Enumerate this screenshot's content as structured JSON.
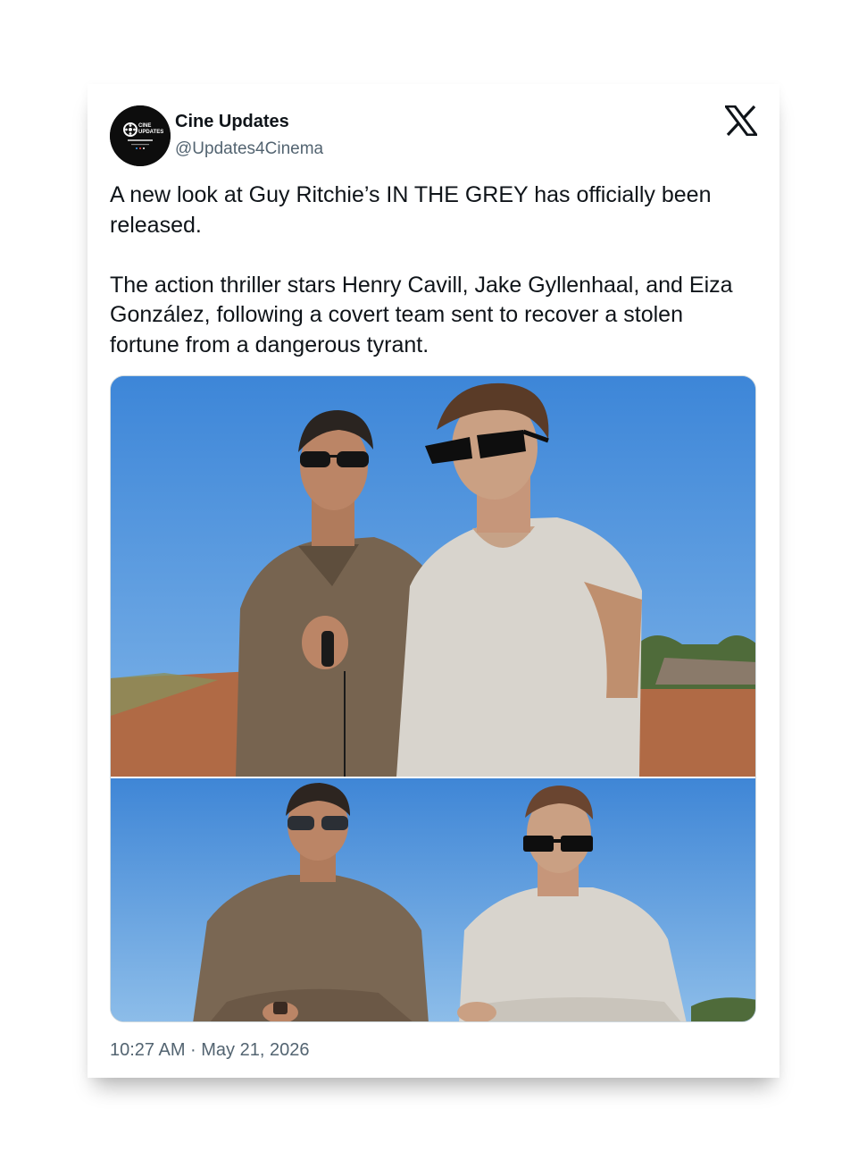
{
  "author": {
    "display_name": "Cine Updates",
    "handle": "@Updates4Cinema",
    "avatar_text": [
      "CINE",
      "UPDATES"
    ]
  },
  "platform": {
    "logo_icon": "x-logo-icon"
  },
  "tweet": {
    "paragraph_1": "A new look at Guy Ritchie’s IN THE GREY has officially been released.",
    "paragraph_2": "The action thriller stars Henry Cavill, Jake Gyllenhaal, and Eiza González, following a covert team sent to recover a stolen fortune from a dangerous tyrant."
  },
  "timestamp": "10:27 AM · May 21, 2026",
  "colors": {
    "text_primary": "#0f1419",
    "text_secondary": "#536471",
    "sky": "#4d8fd6"
  }
}
